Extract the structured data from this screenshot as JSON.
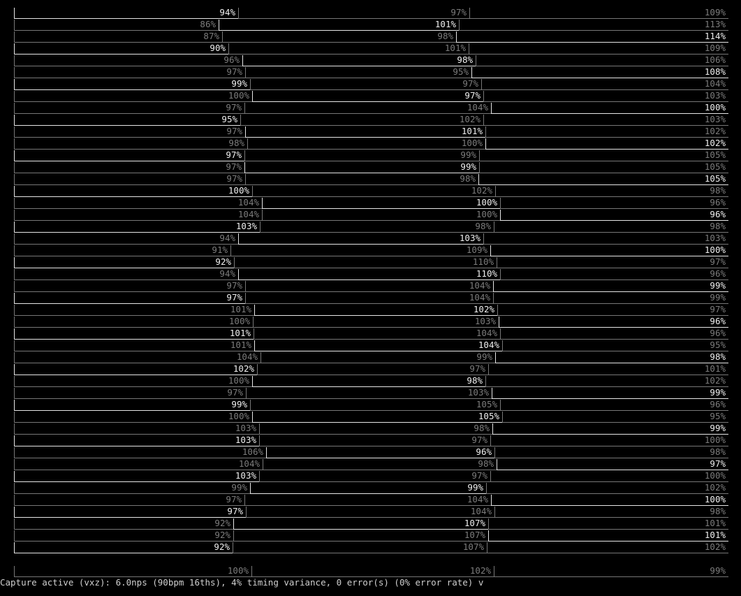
{
  "rows": [
    {
      "active": 0,
      "segments": [
        "94%",
        "97%",
        "109%"
      ]
    },
    {
      "active": 1,
      "segments": [
        "86%",
        "101%",
        "113%"
      ]
    },
    {
      "active": 2,
      "segments": [
        "87%",
        "98%",
        "114%"
      ]
    },
    {
      "active": 0,
      "segments": [
        "90%",
        "101%",
        "109%"
      ]
    },
    {
      "active": 1,
      "segments": [
        "96%",
        "98%",
        "106%"
      ]
    },
    {
      "active": 2,
      "segments": [
        "97%",
        "95%",
        "108%"
      ]
    },
    {
      "active": 0,
      "segments": [
        "99%",
        "97%",
        "104%"
      ]
    },
    {
      "active": 1,
      "segments": [
        "100%",
        "97%",
        "103%"
      ]
    },
    {
      "active": 2,
      "segments": [
        "97%",
        "104%",
        "100%"
      ]
    },
    {
      "active": 0,
      "segments": [
        "95%",
        "102%",
        "103%"
      ]
    },
    {
      "active": 1,
      "segments": [
        "97%",
        "101%",
        "102%"
      ]
    },
    {
      "active": 2,
      "segments": [
        "98%",
        "100%",
        "102%"
      ]
    },
    {
      "active": 0,
      "segments": [
        "97%",
        "99%",
        "105%"
      ]
    },
    {
      "active": 1,
      "segments": [
        "97%",
        "99%",
        "105%"
      ]
    },
    {
      "active": 2,
      "segments": [
        "97%",
        "98%",
        "105%"
      ]
    },
    {
      "active": 0,
      "segments": [
        "100%",
        "102%",
        "98%"
      ]
    },
    {
      "active": 1,
      "segments": [
        "104%",
        "100%",
        "96%"
      ]
    },
    {
      "active": 2,
      "segments": [
        "104%",
        "100%",
        "96%"
      ]
    },
    {
      "active": 0,
      "segments": [
        "103%",
        "98%",
        "98%"
      ]
    },
    {
      "active": 1,
      "segments": [
        "94%",
        "103%",
        "103%"
      ]
    },
    {
      "active": 2,
      "segments": [
        "91%",
        "109%",
        "100%"
      ]
    },
    {
      "active": 0,
      "segments": [
        "92%",
        "110%",
        "97%"
      ]
    },
    {
      "active": 1,
      "segments": [
        "94%",
        "110%",
        "96%"
      ]
    },
    {
      "active": 2,
      "segments": [
        "97%",
        "104%",
        "99%"
      ]
    },
    {
      "active": 0,
      "segments": [
        "97%",
        "104%",
        "99%"
      ]
    },
    {
      "active": 1,
      "segments": [
        "101%",
        "102%",
        "97%"
      ]
    },
    {
      "active": 2,
      "segments": [
        "100%",
        "103%",
        "96%"
      ]
    },
    {
      "active": 0,
      "segments": [
        "101%",
        "104%",
        "96%"
      ]
    },
    {
      "active": 1,
      "segments": [
        "101%",
        "104%",
        "95%"
      ]
    },
    {
      "active": 2,
      "segments": [
        "104%",
        "99%",
        "98%"
      ]
    },
    {
      "active": 0,
      "segments": [
        "102%",
        "97%",
        "101%"
      ]
    },
    {
      "active": 1,
      "segments": [
        "100%",
        "98%",
        "102%"
      ]
    },
    {
      "active": 2,
      "segments": [
        "97%",
        "103%",
        "99%"
      ]
    },
    {
      "active": 0,
      "segments": [
        "99%",
        "105%",
        "96%"
      ]
    },
    {
      "active": 1,
      "segments": [
        "100%",
        "105%",
        "95%"
      ]
    },
    {
      "active": 2,
      "segments": [
        "103%",
        "98%",
        "99%"
      ]
    },
    {
      "active": 0,
      "segments": [
        "103%",
        "97%",
        "100%"
      ]
    },
    {
      "active": 1,
      "segments": [
        "106%",
        "96%",
        "98%"
      ]
    },
    {
      "active": 2,
      "segments": [
        "104%",
        "98%",
        "97%"
      ]
    },
    {
      "active": 0,
      "segments": [
        "103%",
        "97%",
        "100%"
      ]
    },
    {
      "active": 1,
      "segments": [
        "99%",
        "99%",
        "102%"
      ]
    },
    {
      "active": 2,
      "segments": [
        "97%",
        "104%",
        "100%"
      ]
    },
    {
      "active": 0,
      "segments": [
        "97%",
        "104%",
        "98%"
      ]
    },
    {
      "active": 1,
      "segments": [
        "92%",
        "107%",
        "101%"
      ]
    },
    {
      "active": 2,
      "segments": [
        "92%",
        "107%",
        "101%"
      ]
    },
    {
      "active": 0,
      "segments": [
        "92%",
        "107%",
        "102%"
      ]
    }
  ],
  "summary": {
    "segments": [
      "100%",
      "102%",
      "99%"
    ]
  },
  "status": {
    "text": "Capture active (vxz): 6.0nps (90bpm 16ths), 4% timing variance, 0 error(s) (0% error rate) v"
  }
}
